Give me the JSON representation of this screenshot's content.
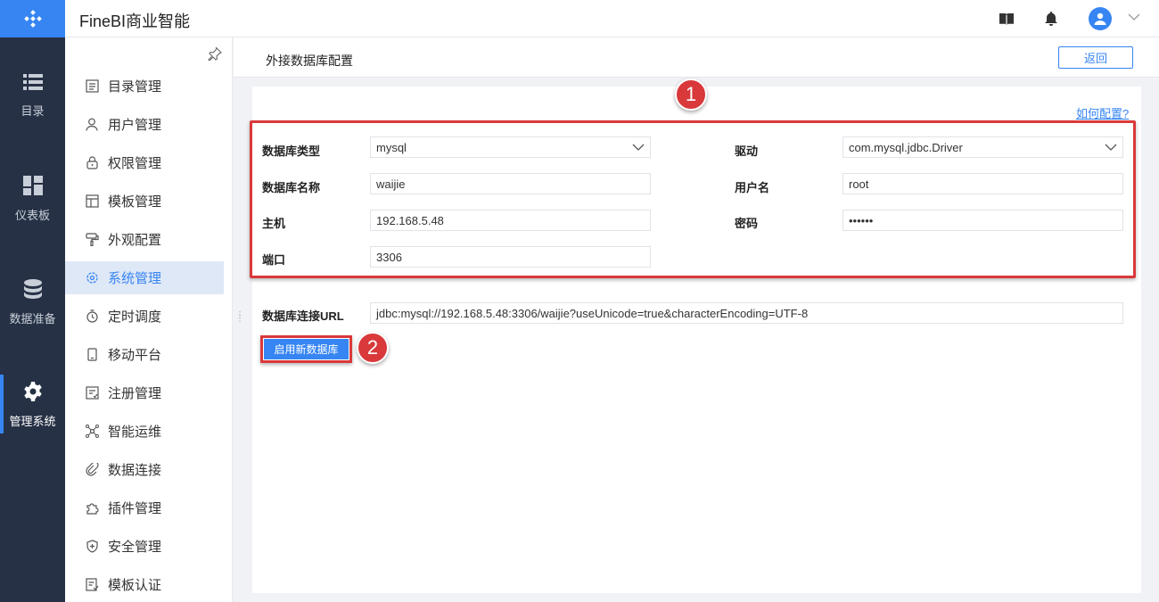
{
  "app": {
    "title": "FineBI商业智能"
  },
  "rail": {
    "items": [
      {
        "label": "目录",
        "icon": "list-icon"
      },
      {
        "label": "仪表板",
        "icon": "dashboard-icon"
      },
      {
        "label": "数据准备",
        "icon": "database-icon"
      },
      {
        "label": "管理系统",
        "icon": "gear-icon",
        "active": true
      }
    ]
  },
  "subnav": {
    "items": [
      {
        "label": "目录管理",
        "icon": "catalog-icon"
      },
      {
        "label": "用户管理",
        "icon": "user-icon"
      },
      {
        "label": "权限管理",
        "icon": "lock-icon"
      },
      {
        "label": "模板管理",
        "icon": "template-icon"
      },
      {
        "label": "外观配置",
        "icon": "brush-icon"
      },
      {
        "label": "系统管理",
        "icon": "settings-icon",
        "active": true
      },
      {
        "label": "定时调度",
        "icon": "timer-icon"
      },
      {
        "label": "移动平台",
        "icon": "mobile-icon"
      },
      {
        "label": "注册管理",
        "icon": "register-icon"
      },
      {
        "label": "智能运维",
        "icon": "ops-icon"
      },
      {
        "label": "数据连接",
        "icon": "link-icon"
      },
      {
        "label": "插件管理",
        "icon": "plugin-icon"
      },
      {
        "label": "安全管理",
        "icon": "shield-icon"
      },
      {
        "label": "模板认证",
        "icon": "certify-icon"
      }
    ]
  },
  "page": {
    "title": "外接数据库配置",
    "back_label": "返回",
    "howto": "如何配置?"
  },
  "form": {
    "db_type": {
      "label": "数据库类型",
      "value": "mysql"
    },
    "driver": {
      "label": "驱动",
      "value": "com.mysql.jdbc.Driver"
    },
    "db_name": {
      "label": "数据库名称",
      "value": "waijie"
    },
    "username": {
      "label": "用户名",
      "value": "root"
    },
    "host": {
      "label": "主机",
      "value": "192.168.5.48"
    },
    "password": {
      "label": "密码",
      "value": "••••••"
    },
    "port": {
      "label": "端口",
      "value": "3306"
    },
    "url": {
      "label": "数据库连接URL",
      "value": "jdbc:mysql://192.168.5.48:3306/waijie?useUnicode=true&characterEncoding=UTF-8"
    },
    "submit_label": "启用新数据库"
  },
  "annotations": {
    "badge1": "1",
    "badge2": "2"
  },
  "colors": {
    "accent": "#3685f2",
    "rail": "#263145",
    "highlight": "#d9393b"
  }
}
